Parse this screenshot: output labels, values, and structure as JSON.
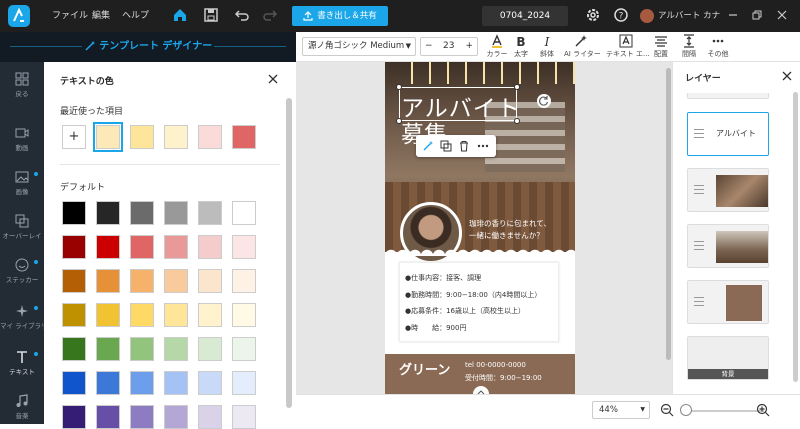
{
  "menu": {
    "file": "ファイル",
    "edit": "編集",
    "help": "ヘルプ"
  },
  "export_label": "書き出し＆共有",
  "doc_name": "0704_2024",
  "user_name": "アルバート カナ",
  "designer_title": "テンプレート デザイナー",
  "toolbar": {
    "font_name": "源ノ角ゴシック Medium",
    "font_size": "23",
    "minus": "−",
    "plus": "+",
    "items": [
      "カラー",
      "太字",
      "斜体",
      "AI ライター",
      "テキスト エ...",
      "配置",
      "間隔",
      "その他"
    ]
  },
  "rail": [
    "戻る",
    "動画",
    "画像",
    "オーバーレイ",
    "ステッカー",
    "マイ ライブラリ",
    "テキスト",
    "音楽"
  ],
  "panel": {
    "title": "テキストの色",
    "recent_label": "最近使った項目",
    "add": "+",
    "recent": [
      "#fde9b8",
      "#fde59a",
      "#fdf2cc",
      "#fbdada",
      "#e06666"
    ],
    "default_label": "デフォルト",
    "default_colors": [
      [
        "#000000",
        "#262626",
        "#6b6b6b",
        "#999999",
        "#bcbcbc",
        "#ffffff"
      ],
      [
        "#990000",
        "#cc0000",
        "#e06666",
        "#ea9999",
        "#f4cccc",
        "#fce5e5"
      ],
      [
        "#b45f06",
        "#e69138",
        "#f6b26b",
        "#f9cb9c",
        "#fce5cd",
        "#fef2e6"
      ],
      [
        "#bf9000",
        "#f1c232",
        "#ffd966",
        "#ffe599",
        "#fff2cc",
        "#fff9e6"
      ],
      [
        "#38761d",
        "#6aa84f",
        "#93c47d",
        "#b6d7a8",
        "#d9ead3",
        "#ecf5e9"
      ],
      [
        "#1155cc",
        "#3c78d8",
        "#6d9eeb",
        "#a4c2f4",
        "#c9daf8",
        "#e4edfc"
      ],
      [
        "#351c75",
        "#674ea7",
        "#8e7cc3",
        "#b4a7d6",
        "#d9d2e9",
        "#ece9f4"
      ]
    ]
  },
  "poster": {
    "headline1": "アルバイト",
    "headline2": "募集",
    "tagline": "珈琲の香りに包まれて、\n一緒に働きませんか？",
    "details": [
      "●仕事内容：接客、調理",
      "●勤務時間：9:00−18:00（内4時間以上）",
      "●応募条件：16歳以上（高校生以上）",
      "●時　　給：900円"
    ],
    "shop_name": "グリーン",
    "tel": "tel 00-0000-0000",
    "hours": "受付時間：9:00−19:00"
  },
  "zoom": "44%",
  "layers": {
    "title": "レイヤー",
    "text_layer": "アルバイト",
    "bg_layer": "背景"
  },
  "colors": {
    "accent": "#1aa6e8",
    "dark": "#1f1f1f",
    "brown": "#8a6a55"
  }
}
